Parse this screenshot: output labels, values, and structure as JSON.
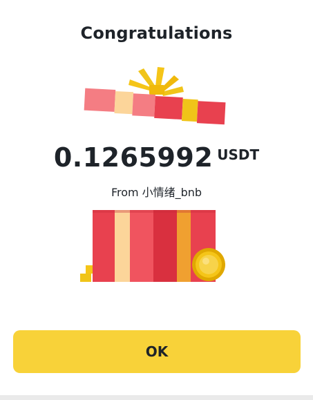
{
  "dialog": {
    "title": "Congratulations",
    "amount": "0.1265992",
    "currency": "USDT",
    "sender_prefix": "From",
    "sender_name": "小情绪_bnb",
    "ok_label": "OK"
  },
  "colors": {
    "accent_yellow": "#f8d239",
    "gift_red": "#e8414f",
    "gift_pink": "#f47d83",
    "gift_light": "#fcd59a",
    "ribbon_gold": "#f0b90b",
    "text_dark": "#1e2329"
  },
  "icons": {
    "gift_lid": "gift-lid-icon",
    "gift_box": "gift-box-icon",
    "coin": "coin-icon"
  }
}
